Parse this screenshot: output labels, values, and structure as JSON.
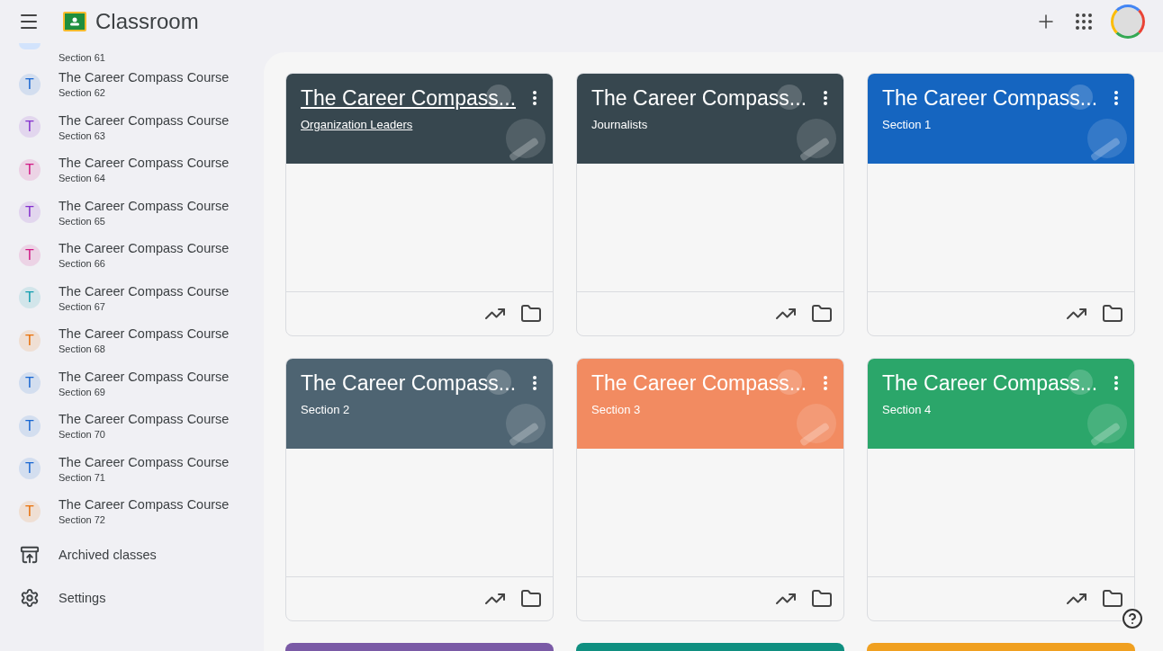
{
  "app": {
    "title": "Classroom"
  },
  "sidebar": {
    "courses": [
      {
        "section": "Section 61",
        "color": "#d2e3fc"
      },
      {
        "title": "The Career Compass Course",
        "section": "Section 62",
        "letter": "T",
        "color": "#1967d2"
      },
      {
        "title": "The Career Compass Course",
        "section": "Section 63",
        "letter": "T",
        "color": "#8430ce"
      },
      {
        "title": "The Career Compass Course",
        "section": "Section 64",
        "letter": "T",
        "color": "#d01884"
      },
      {
        "title": "The Career Compass Course",
        "section": "Section 65",
        "letter": "T",
        "color": "#8430ce"
      },
      {
        "title": "The Career Compass Course",
        "section": "Section 66",
        "letter": "T",
        "color": "#d01884"
      },
      {
        "title": "The Career Compass Course",
        "section": "Section 67",
        "letter": "T",
        "color": "#129eaf"
      },
      {
        "title": "The Career Compass Course",
        "section": "Section 68",
        "letter": "T",
        "color": "#e8710a"
      },
      {
        "title": "The Career Compass Course",
        "section": "Section 69",
        "letter": "T",
        "color": "#1967d2"
      },
      {
        "title": "The Career Compass Course",
        "section": "Section 70",
        "letter": "T",
        "color": "#1967d2"
      },
      {
        "title": "The Career Compass Course",
        "section": "Section 71",
        "letter": "T",
        "color": "#1967d2"
      },
      {
        "title": "The Career Compass Course",
        "section": "Section 72",
        "letter": "T",
        "color": "#e8710a"
      }
    ],
    "links": [
      {
        "kind": "archive",
        "label": "Archived classes"
      },
      {
        "kind": "settings",
        "label": "Settings"
      }
    ]
  },
  "cards": [
    {
      "title": "The Career Compass...",
      "subtitle": "Organization Leaders",
      "color": "#37474f",
      "hovered": true
    },
    {
      "title": "The Career Compass...",
      "subtitle": "Journalists",
      "color": "#37474f",
      "hovered": false
    },
    {
      "title": "The Career Compass...",
      "subtitle": "Section 1",
      "color": "#1565c0",
      "hovered": false
    },
    {
      "title": "The Career Compass...",
      "subtitle": "Section 2",
      "color": "#4e6472",
      "hovered": false
    },
    {
      "title": "The Career Compass...",
      "subtitle": "Section 3",
      "color": "#f28b61",
      "hovered": false
    },
    {
      "title": "The Career Compass...",
      "subtitle": "Section 4",
      "color": "#2ba66a",
      "hovered": false
    }
  ],
  "peek_cards": [
    {
      "color": "#7a5aa6"
    },
    {
      "color": "#0f8f80"
    },
    {
      "color": "#f0a020"
    }
  ]
}
